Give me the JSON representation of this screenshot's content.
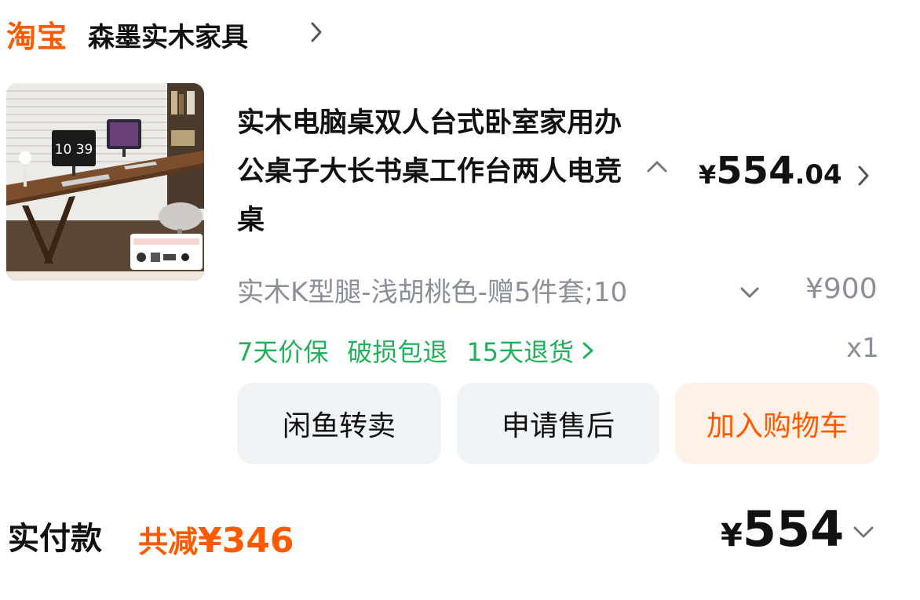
{
  "header": {
    "logo_text": "淘宝",
    "shop_name": "森墨实木家具"
  },
  "product": {
    "image_alt_icon": "desk-photo",
    "title": "实木电脑桌双人台式卧室家用办公桌子大长书桌工作台两人电竞桌",
    "price_currency": "¥",
    "price_integer": "554",
    "price_decimal": ".04",
    "sku": "实木K型腿-浅胡桃色-赠5件套;10",
    "original_price": "¥900",
    "quantity": "x1",
    "services": [
      "7天价保",
      "破损包退",
      "15天退货"
    ],
    "image_clock_text": "10 39"
  },
  "actions": {
    "resell_label": "闲鱼转卖",
    "aftersale_label": "申请售后",
    "add_cart_label": "加入购物车"
  },
  "footer": {
    "paid_label": "实付款",
    "discount_label": "共减",
    "discount_amount": "¥346",
    "total_currency": "¥",
    "total_amount": "554"
  },
  "colors": {
    "brand": "#ff5a00",
    "service_green": "#22b05a",
    "muted": "#8a8f99",
    "button_grey": "#f1f4f7",
    "button_orange_bg": "#fff1e7"
  }
}
